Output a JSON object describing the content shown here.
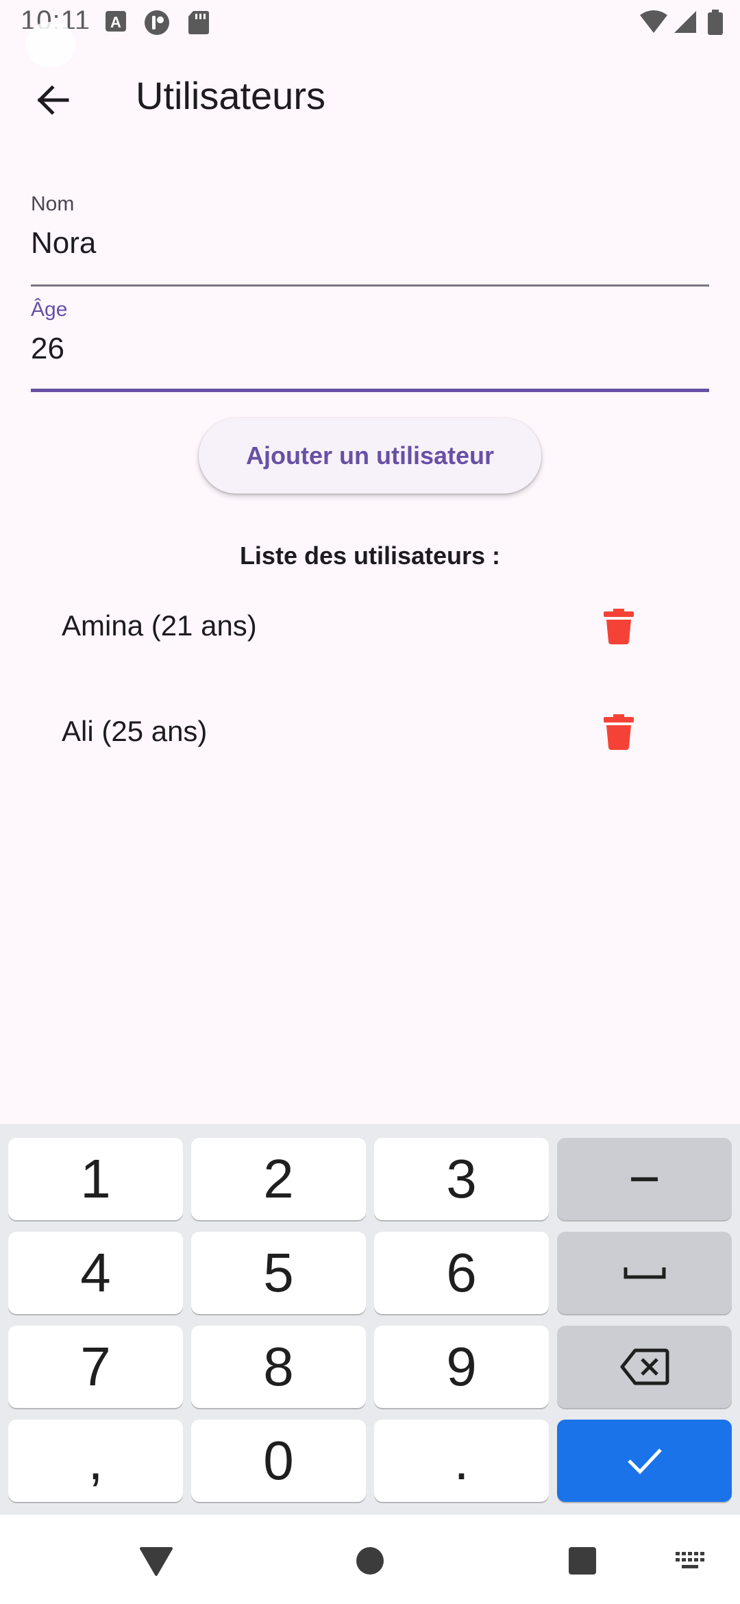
{
  "status_bar": {
    "time": "10:11"
  },
  "app_bar": {
    "title": "Utilisateurs"
  },
  "form": {
    "name_label": "Nom",
    "name_value": "Nora",
    "age_label": "Âge",
    "age_value": "26",
    "add_button_label": "Ajouter un utilisateur"
  },
  "list": {
    "title": "Liste des utilisateurs :",
    "users": [
      {
        "label": "Amina (21 ans)"
      },
      {
        "label": "Ali (25 ans)"
      }
    ]
  },
  "keyboard": {
    "keys": [
      "1",
      "2",
      "3",
      "−",
      "4",
      "5",
      "6",
      "7",
      "8",
      "9",
      ",",
      "0",
      "."
    ]
  },
  "colors": {
    "background": "#FEF7FC",
    "accent": "#6750A4",
    "delete": "#F44336",
    "enter_key": "#1A73E8"
  },
  "icons": [
    "back-arrow-icon",
    "trash-icon",
    "space-icon",
    "backspace-icon",
    "check-icon",
    "nav-back-icon",
    "nav-home-icon",
    "nav-recents-icon",
    "keyboard-icon"
  ]
}
